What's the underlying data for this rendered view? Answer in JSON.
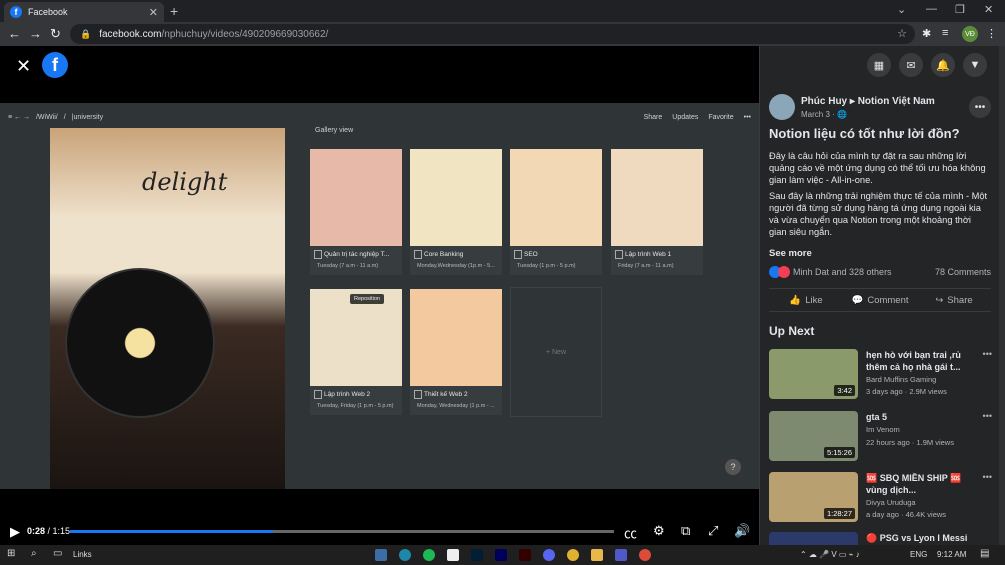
{
  "browser": {
    "tab_title": "Facebook",
    "url_host": "facebook.com",
    "url_path": "/nphuchuy/videos/490209669030662/",
    "profile_initials": "VĐ"
  },
  "notion": {
    "breadcrumb_1": "/WiWii/",
    "breadcrumb_2": "/",
    "breadcrumb_3": "|university",
    "share": "Share",
    "updates": "Updates",
    "favorite": "Favorite",
    "gallery_view": "Gallery view",
    "cover_word": "delight",
    "new_label": "+ New",
    "reposition": "Reposition",
    "cards": [
      {
        "title": "Quản trị tác nghiệp T...",
        "sub": "Tuesday (7 a.m - 11 a.m)",
        "color": "#e7b9a8"
      },
      {
        "title": "Core Banking",
        "sub": "Monday,Wednesday (1p.m - 5...",
        "color": "#f1e4c3"
      },
      {
        "title": "SEO",
        "sub": "Tuesday (1 p.m - 5 p.m)",
        "color": "#f3d8b5"
      },
      {
        "title": "Lập trình Web 1",
        "sub": "Friday (7 a.m - 11 a.m)",
        "color": "#efd9bf"
      },
      {
        "title": "Lập trình Web 2",
        "sub": "Tuesday, Friday (1 p.m - 5 p.m)",
        "color": "#ece0c8"
      },
      {
        "title": "Thiết kế Web 2",
        "sub": "Monday, Wednesday (1 p.m - ...",
        "color": "#f3c9a0"
      }
    ]
  },
  "player": {
    "current_time": "0:28",
    "separator": " / ",
    "total_time": "1:15",
    "progress": 0.373
  },
  "post": {
    "author": "Phúc Huy",
    "group": "Notion Việt Nam",
    "date": "March 3 · ",
    "title": "Notion liệu có tốt như lời đồn?",
    "body_1": "Đây là câu hỏi của mình tự đặt ra sau những lời quảng cáo về một ứng dụng có thể tối ưu hóa không gian làm việc - All-in-one.",
    "body_2": "Sau đây là những trải nghiệm thực tế của mình - Một người đã từng sử dụng hàng tá ứng dụng ngoài kia và vừa chuyển qua Notion trong một khoảng thời gian siêu ngắn.",
    "see_more": "See more",
    "reactions": "Minh Dat and 328 others",
    "comments_count": "78 Comments",
    "like": "Like",
    "comment": "Comment",
    "share": "Share"
  },
  "up_next": {
    "heading": "Up Next",
    "videos": [
      {
        "title": "hẹn hò với bạn trai ,rủ thêm cả họ nhà gái t...",
        "channel": "Bard Muffins Gaming",
        "meta": "3 days ago · 2.9M views",
        "duration": "3:42",
        "color": "#8a9a6a"
      },
      {
        "title": "gta 5",
        "channel": "Im Venom",
        "meta": "22 hours ago · 1.9M views",
        "duration": "5:15:26",
        "color": "#7d8a70"
      },
      {
        "title": "🆘 SBQ MIỀN SHIP 🆘 vùng dịch...",
        "channel": "Divya Uruduga",
        "meta": "a day ago · 46.4K views",
        "duration": "1:28:27",
        "color": "#b8a070"
      },
      {
        "title": "🔴 PSG vs Lyon I Messi",
        "channel": "",
        "meta": "",
        "duration": "",
        "color": "#2b3a6a"
      }
    ]
  },
  "taskbar": {
    "links": "Links",
    "lang": "ENG",
    "time": "9:12 AM"
  },
  "colors": {
    "facebook_blue": "#1877f2",
    "panel_bg": "#242526",
    "notion_bg": "#2f3437"
  }
}
